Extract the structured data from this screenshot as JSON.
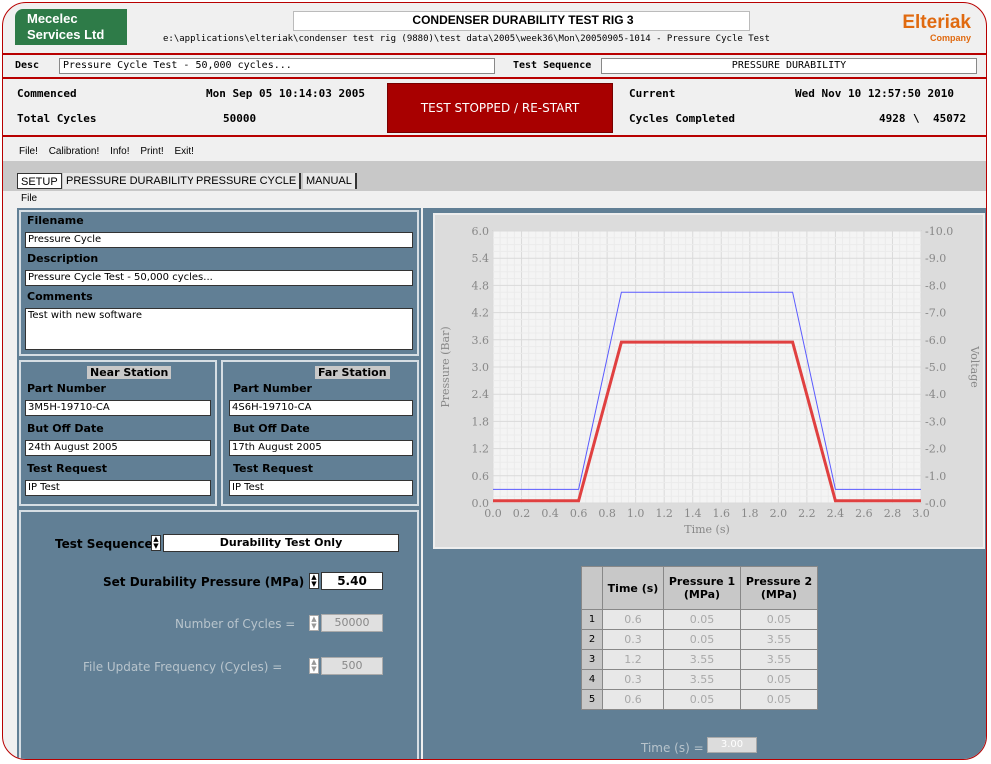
{
  "header": {
    "company_line1": "Mecelec",
    "company_line2": "Services Ltd",
    "title": "CONDENSER DURABILITY TEST RIG 3",
    "path": "e:\\applications\\elteriak\\condenser test rig (9880)\\test data\\2005\\week36\\Mon\\20050905-1014 - Pressure Cycle Test",
    "brand_name": "Elteriak",
    "brand_sub": "Company"
  },
  "desc_row": {
    "desc_label": "Desc",
    "desc_value": "Pressure Cycle Test - 50,000 cycles...",
    "seq_label": "Test Sequence",
    "seq_value": "PRESSURE DURABILITY"
  },
  "status": {
    "commenced_label": "Commenced",
    "commenced_value": "Mon Sep 05 10:14:03 2005",
    "total_label": "Total Cycles",
    "total_value": "50000",
    "stop_button": "TEST STOPPED / RE-START",
    "current_label": "Current",
    "current_value": "Wed Nov 10 12:57:50 2010",
    "completed_label": "Cycles Completed",
    "completed_value1": "4928",
    "completed_sep": "\\",
    "completed_value2": "45072"
  },
  "menu": [
    "File!",
    "Calibration!",
    "Info!",
    "Print!",
    "Exit!"
  ],
  "tabs": [
    "SETUP",
    "PRESSURE DURABILITY",
    "PRESSURE CYCLE",
    "MANUAL"
  ],
  "submenu_file": "File",
  "setup": {
    "filename_label": "Filename",
    "filename_value": "Pressure Cycle",
    "description_label": "Description",
    "description_value": "Pressure Cycle Test - 50,000 cycles...",
    "comments_label": "Comments",
    "comments_value": "Test with new software"
  },
  "near": {
    "title": "Near Station",
    "part_label": "Part Number",
    "part_value": "3M5H-19710-CA",
    "date_label": "But Off Date",
    "date_value": "24th August 2005",
    "req_label": "Test Request",
    "req_value": "IP Test"
  },
  "far": {
    "title": "Far Station",
    "part_label": "Part Number",
    "part_value": "4S6H-19710-CA",
    "date_label": "But Off Date",
    "date_value": "17th August 2005",
    "req_label": "Test Request",
    "req_value": "IP Test"
  },
  "controls": {
    "seq_label": "Test Sequence",
    "seq_value": "Durability Test Only",
    "pressure_label": "Set Durability Pressure (MPa) =",
    "pressure_value": "5.40",
    "cycles_label": "Number of Cycles =",
    "cycles_value": "50000",
    "freq_label": "File Update Frequency (Cycles) =",
    "freq_value": "500"
  },
  "chart_data": {
    "type": "line",
    "xlabel": "Time (s)",
    "ylabel": "Pressure (Bar)",
    "y2label": "Voltage",
    "xlim": [
      0.0,
      3.0
    ],
    "ylim": [
      0.0,
      6.0
    ],
    "y2lim": [
      0.0,
      -10.0
    ],
    "xticks": [
      "0.0",
      "0.2",
      "0.4",
      "0.6",
      "0.8",
      "1.0",
      "1.2",
      "1.4",
      "1.6",
      "1.8",
      "2.0",
      "2.2",
      "2.4",
      "2.6",
      "2.8",
      "3.0"
    ],
    "yticks": [
      "0.0",
      "0.6",
      "1.2",
      "1.8",
      "2.4",
      "3.0",
      "3.6",
      "4.2",
      "4.8",
      "5.4",
      "6.0"
    ],
    "y2ticks": [
      "-0.0",
      "-1.0",
      "-2.0",
      "-3.0",
      "-4.0",
      "-5.0",
      "-6.0",
      "-7.0",
      "-8.0",
      "-9.0",
      "-10.0"
    ],
    "grid": true,
    "series": [
      {
        "color": "#5a5aff",
        "x": [
          0.0,
          0.6,
          0.9,
          2.1,
          2.4,
          3.0
        ],
        "y": [
          0.3,
          0.3,
          4.65,
          4.65,
          0.3,
          0.3
        ]
      },
      {
        "color": "#e04040",
        "x": [
          0.0,
          0.6,
          0.9,
          2.1,
          2.4,
          3.0
        ],
        "y": [
          0.05,
          0.05,
          3.55,
          3.55,
          0.05,
          0.05
        ]
      }
    ]
  },
  "table": {
    "headers": [
      "Time (s)",
      "Pressure 1 (MPa)",
      "Pressure 2 (MPa)"
    ],
    "rows": [
      {
        "n": "1",
        "t": "0.6",
        "p1": "0.05",
        "p2": "0.05"
      },
      {
        "n": "2",
        "t": "0.3",
        "p1": "0.05",
        "p2": "3.55"
      },
      {
        "n": "3",
        "t": "1.2",
        "p1": "3.55",
        "p2": "3.55"
      },
      {
        "n": "4",
        "t": "0.3",
        "p1": "3.55",
        "p2": "0.05"
      },
      {
        "n": "5",
        "t": "0.6",
        "p1": "0.05",
        "p2": "0.05"
      }
    ]
  },
  "time_total": {
    "label": "Time (s) =",
    "value": "3.00"
  }
}
